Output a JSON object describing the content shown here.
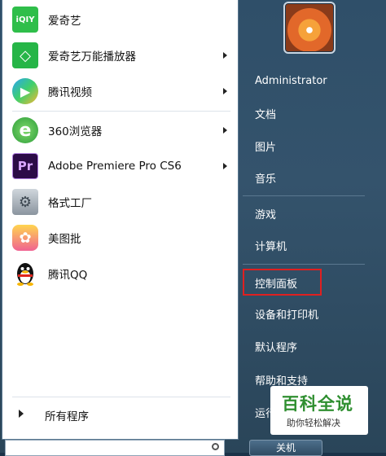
{
  "programs": [
    {
      "label": "爱奇艺",
      "icon": "iqiyi-icon",
      "icon_text": "iQIY",
      "color": "#2fbe4a",
      "has_submenu": false
    },
    {
      "label": "爱奇艺万能播放器",
      "icon": "iqiyi-player-icon",
      "icon_text": "◇",
      "color": "#26b547",
      "has_submenu": true
    },
    {
      "label": "腾讯视频",
      "icon": "tencent-video-icon",
      "icon_text": "▶",
      "color": "#2aa4f4",
      "has_submenu": true
    },
    {
      "label": "360浏览器",
      "icon": "360-browser-icon",
      "icon_text": "e",
      "color": "#49b847",
      "has_submenu": true
    },
    {
      "label": "Adobe Premiere Pro CS6",
      "icon": "premiere-pro-icon",
      "icon_text": "Pr",
      "color": "#2c0b47",
      "has_submenu": true
    },
    {
      "label": "格式工厂",
      "icon": "format-factory-icon",
      "icon_text": "⚙",
      "color": "#9aa4ad",
      "has_submenu": false
    },
    {
      "label": "美图批",
      "icon": "meitu-icon",
      "icon_text": "✿",
      "color": "#e8607a",
      "has_submenu": false
    },
    {
      "label": "腾讯QQ",
      "icon": "qq-penguin-icon",
      "icon_text": "●",
      "color": "#111111",
      "has_submenu": false
    }
  ],
  "all_programs": "所有程序",
  "user": {
    "name": "Administrator"
  },
  "right_items": [
    {
      "label": "文档"
    },
    {
      "label": "图片"
    },
    {
      "label": "音乐"
    },
    {
      "label": "游戏"
    },
    {
      "label": "计算机"
    },
    {
      "label": "控制面板"
    },
    {
      "label": "设备和打印机"
    },
    {
      "label": "默认程序"
    },
    {
      "label": "帮助和支持"
    },
    {
      "label": "运行..."
    }
  ],
  "shutdown_label": "关机",
  "watermark": {
    "title": "百科全说",
    "subtitle": "助你轻松解决"
  }
}
